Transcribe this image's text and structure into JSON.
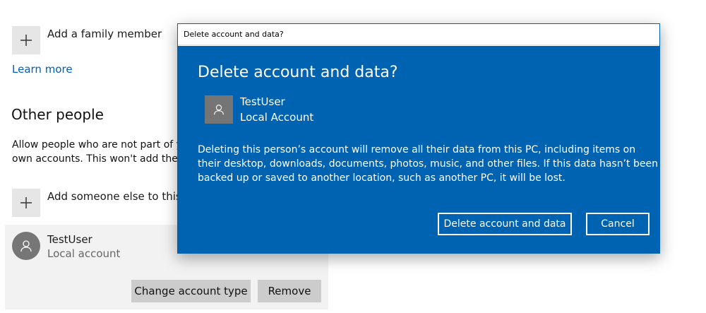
{
  "family": {
    "add_label": "Add a family member",
    "learn_more": "Learn more"
  },
  "other_people": {
    "heading": "Other people",
    "description_line1": "Allow people who are not part of yo",
    "description_line2": "own accounts. This won't add them",
    "add_label": "Add someone else to this PC"
  },
  "user_entry": {
    "name": "TestUser",
    "type": "Local account",
    "change_type_label": "Change account type",
    "remove_label": "Remove"
  },
  "dialog": {
    "window_title": "Delete account and data?",
    "title": "Delete account and data?",
    "user_name": "TestUser",
    "user_type": "Local Account",
    "message_line1": "Deleting this person’s account will remove all their data from this PC, including items on",
    "message_line2": "their desktop, downloads, documents, photos, music, and other files. If this data hasn’t been",
    "message_line3": "backed up or saved to another location, such as another PC, it will be lost.",
    "confirm_label": "Delete account and data",
    "cancel_label": "Cancel"
  },
  "icons": {
    "plus": "plus-icon",
    "person": "person-icon"
  },
  "colors": {
    "dialog_bg": "#0063b1",
    "link": "#005fb8",
    "tile": "#e6e6e6",
    "panel": "#f2f2f2"
  }
}
